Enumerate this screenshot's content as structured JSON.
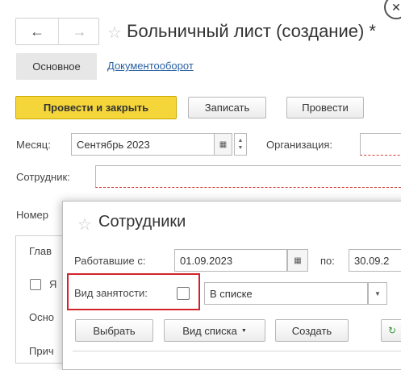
{
  "window": {
    "title": "Больничный лист (создание) *",
    "nav_back": "←",
    "nav_forward": "→",
    "star": "☆",
    "close": "✕"
  },
  "tabs": {
    "main": "Основное",
    "docflow": "Документооборот"
  },
  "toolbar": {
    "post_close": "Провести и закрыть",
    "save": "Записать",
    "post": "Провести"
  },
  "form": {
    "month_label": "Месяц:",
    "month_value": "Сентябрь 2023",
    "org_label": "Организация:",
    "employee_label": "Сотрудник:",
    "number_label": "Номер"
  },
  "left_panel": {
    "tab_fragment": "Глав",
    "check_fragment": "Я",
    "osn_fragment": "Осно",
    "prich_fragment": "Прич"
  },
  "dialog": {
    "title": "Сотрудники",
    "worked_from_label": "Работавшие с:",
    "date_from": "01.09.2023",
    "to_label": "по:",
    "date_to": "30.09.2",
    "employment_type_label": "Вид занятости:",
    "employment_type_value": "В списке",
    "select_button": "Выбрать",
    "list_view_button": "Вид списка",
    "create_button": "Создать"
  },
  "colors": {
    "accent_yellow": "#f5d63a",
    "highlight_red": "#d2232a",
    "link_blue": "#2a62a3"
  }
}
